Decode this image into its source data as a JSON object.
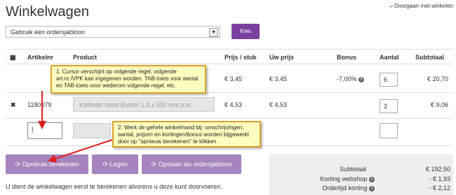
{
  "header": {
    "title": "Winkelwagen",
    "continue_link": "Doorgaan met winkelen"
  },
  "template_select": {
    "value": "Gebruik een ordersjabloon",
    "button": "Kies"
  },
  "table": {
    "columns": [
      "Artikelnr",
      "Product",
      "Prijs / stuk",
      "Uw prijs",
      "Bonus",
      "Aantal",
      "Subtotaal"
    ],
    "rows": [
      {
        "price": "€ 3,45",
        "your_price": "€ 3,45",
        "bonus": "-7,00%",
        "qty": "6",
        "subtotal": "€ 20,70"
      },
      {
        "artnr": "1180079",
        "product": "Katheter hond Buster 1,3 x 500 mm p.st.",
        "price": "€ 4,53",
        "your_price": "€ 4,53",
        "qty": "2",
        "subtotal": "€ 9,06"
      }
    ]
  },
  "callouts": {
    "one": "1. Cursor verschijnt op volgende regel, volgende art.nr./VPK kan ingegeven worden. TAB-toets voor aantal en TAB-toets voor wederom volgende regel, etc.",
    "two": "2. Werk de gehele winkelmand bij: omschrijvingen, aantal, prijzen en kortingen/bonus worden bijgewerkt door op \"opnieuw berekenen\" te klikken"
  },
  "buttons": {
    "recalc": "Opnieuw berekenen",
    "clear": "Legen",
    "save_template": "Opslaan als ordersjabloon"
  },
  "summary": {
    "subtotal_label": "Subtotaal",
    "subtotal_value": "€ 192,50",
    "webshop_label": "Korting webshop",
    "webshop_value": "- € 1,93",
    "orderdate_label": "Ordertijd korting",
    "orderdate_value": "- € 2,12"
  },
  "info_text": "U dient de winkelwagen eerst te berekenen alvorens u deze kunt doorvoeren.",
  "colors": {
    "accent": "#7b3fa0",
    "button": "#a684bd",
    "callout_bg": "#ffffc0",
    "callout_border": "#d9a22b",
    "arrow": "#e02020"
  }
}
